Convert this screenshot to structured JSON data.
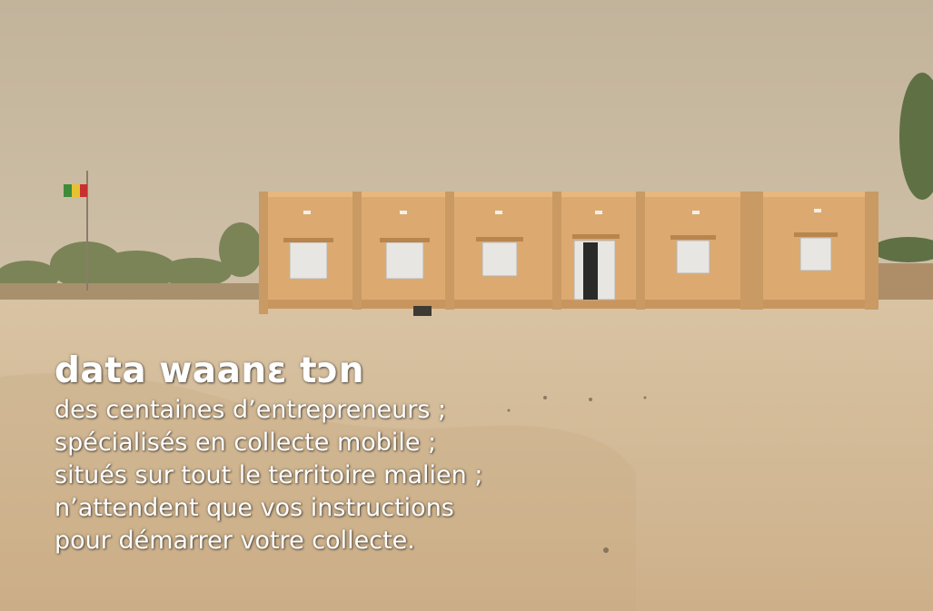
{
  "headline": "data waanɛ tɔn",
  "body_lines": [
    "des centaines d’entrepreneurs ;",
    "spécialisés en collecte mobile ;",
    "situés sur tout le territoire malien ;",
    "n’attendent que vos instructions",
    "pour démarrer votre collecte."
  ],
  "colors": {
    "sky": "#c8b9a1",
    "sand": "#d4bc98",
    "building": "#dcaa70",
    "text": "#ffffff"
  }
}
